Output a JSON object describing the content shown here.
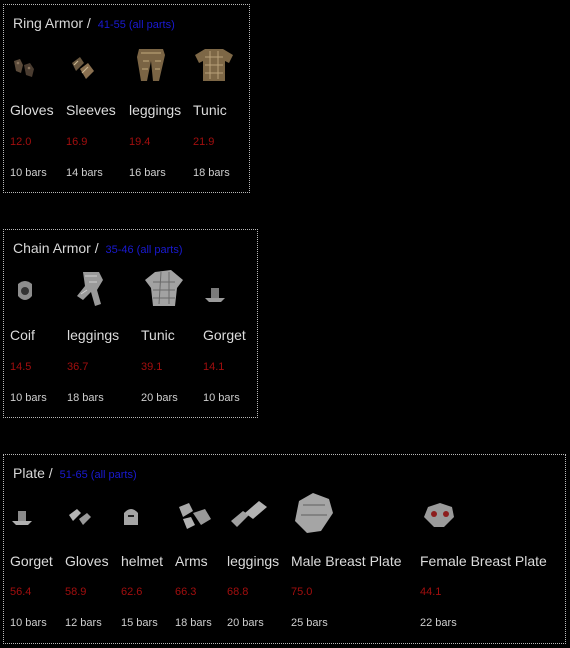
{
  "sections": [
    {
      "title": "Ring Armor",
      "separator": " / ",
      "range": "41-55 (all parts)",
      "items": [
        {
          "name": "Gloves",
          "weight": "12.0",
          "bars": "10 bars",
          "icon": "ring-gloves-icon"
        },
        {
          "name": "Sleeves",
          "weight": "16.9",
          "bars": "14 bars",
          "icon": "ring-sleeves-icon"
        },
        {
          "name": "leggings",
          "weight": "19.4",
          "bars": "16 bars",
          "icon": "ring-leggings-icon"
        },
        {
          "name": "Tunic",
          "weight": "21.9",
          "bars": "18 bars",
          "icon": "ring-tunic-icon"
        }
      ]
    },
    {
      "title": "Chain Armor",
      "separator": " / ",
      "range": "35-46 (all parts)",
      "items": [
        {
          "name": "Coif",
          "weight": "14.5",
          "bars": "10 bars",
          "icon": "chain-coif-icon"
        },
        {
          "name": "leggings",
          "weight": "36.7",
          "bars": "18 bars",
          "icon": "chain-leggings-icon"
        },
        {
          "name": "Tunic",
          "weight": "39.1",
          "bars": "20 bars",
          "icon": "chain-tunic-icon"
        },
        {
          "name": "Gorget",
          "weight": "14.1",
          "bars": "10 bars",
          "icon": "chain-gorget-icon"
        }
      ]
    },
    {
      "title": "Plate",
      "separator": " / ",
      "range": "51-65 (all parts)",
      "items": [
        {
          "name": "Gorget",
          "weight": "56.4",
          "bars": "10 bars",
          "icon": "plate-gorget-icon"
        },
        {
          "name": "Gloves",
          "weight": "58.9",
          "bars": "12 bars",
          "icon": "plate-gloves-icon"
        },
        {
          "name": "helmet",
          "weight": "62.6",
          "bars": "15 bars",
          "icon": "plate-helmet-icon"
        },
        {
          "name": "Arms",
          "weight": "66.3",
          "bars": "18 bars",
          "icon": "plate-arms-icon"
        },
        {
          "name": "leggings",
          "weight": "68.8",
          "bars": "20 bars",
          "icon": "plate-leggings-icon"
        },
        {
          "name": "Male Breast Plate",
          "weight": "75.0",
          "bars": "25 bars",
          "icon": "plate-male-breastplate-icon"
        },
        {
          "name": "Female Breast Plate",
          "weight": "44.1",
          "bars": "22 bars",
          "icon": "plate-female-breastplate-icon"
        }
      ]
    }
  ]
}
